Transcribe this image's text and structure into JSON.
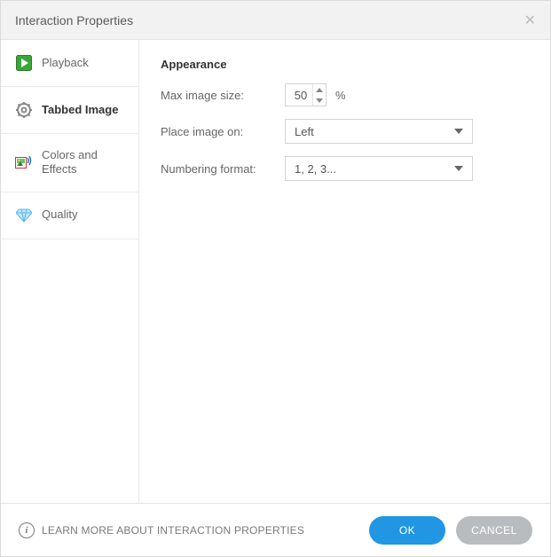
{
  "dialog": {
    "title": "Interaction Properties"
  },
  "sidebar": {
    "items": [
      {
        "label": "Playback"
      },
      {
        "label": "Tabbed Image"
      },
      {
        "label": "Colors and Effects"
      },
      {
        "label": "Quality"
      }
    ]
  },
  "appearance": {
    "section_title": "Appearance",
    "max_image_size_label": "Max image size:",
    "max_image_size_value": "50",
    "max_image_size_unit": "%",
    "place_image_label": "Place image on:",
    "place_image_value": "Left",
    "numbering_label": "Numbering format:",
    "numbering_value": "1, 2, 3..."
  },
  "footer": {
    "learn_more": "LEARN MORE ABOUT INTERACTION PROPERTIES",
    "ok": "OK",
    "cancel": "CANCEL"
  }
}
